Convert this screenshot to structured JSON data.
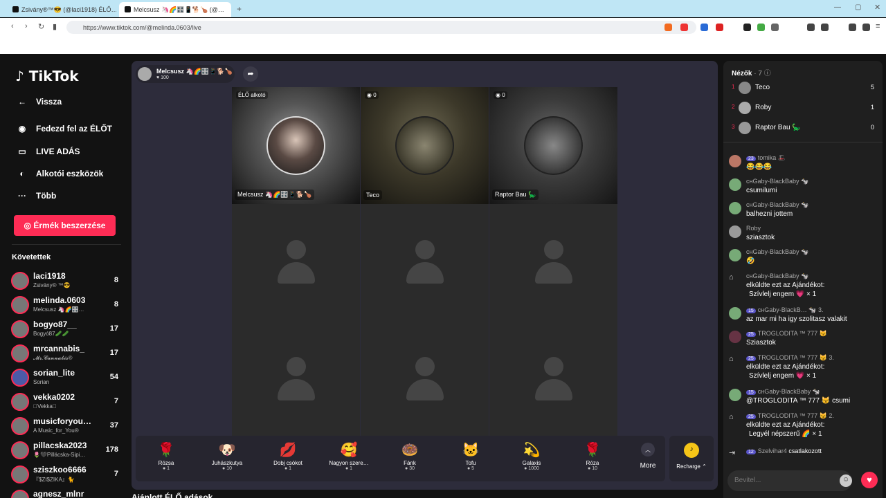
{
  "browser": {
    "tabs": [
      {
        "title": "Zsivány®™😎 (@laci1918) ÉLŐ…"
      },
      {
        "title": "Melcsusz 🦄🌈🎛️📱🐕🍗 (@…"
      }
    ],
    "url": "https://www.tiktok.com/@melinda.0603/live"
  },
  "sidebar": {
    "logo": "TikTok",
    "back": "Vissza",
    "items": [
      {
        "label": "Fedezd fel az ÉLŐT"
      },
      {
        "label": "LIVE ADÁS"
      },
      {
        "label": "Alkotói eszközök"
      },
      {
        "label": "Több"
      }
    ],
    "coins_button": "Érmék beszerzése",
    "following_title": "Követettek",
    "following": [
      {
        "name": "laci1918",
        "sub": "Zsivány® ™😎",
        "count": "8"
      },
      {
        "name": "melinda.0603",
        "sub": "Melcsusz 🦄🌈🎛️…",
        "count": "8"
      },
      {
        "name": "bogyo87__",
        "sub": "Bogyó87🥒🥒",
        "count": "17"
      },
      {
        "name": "mrcannabis_",
        "sub": "𝓜𝓻.𝓒𝓪𝓷𝓷𝓪𝓫𝓲𝓼®",
        "count": "17"
      },
      {
        "name": "sorian_lite",
        "sub": "Sorian",
        "count": "54"
      },
      {
        "name": "vekka0202",
        "sub": "⃟Vekka⃟",
        "count": "7"
      },
      {
        "name": "musicforyou…",
        "sub": "A Music_for_You®",
        "count": "37"
      },
      {
        "name": "pillacska2023",
        "sub": "🌷🖤Pillácska-Sipi…",
        "count": "178"
      },
      {
        "name": "sziszkoo6666",
        "sub": "『$ZI$ZIKA』🐈",
        "count": "7"
      },
      {
        "name": "agnesz_mlnr",
        "sub": "",
        "count": ""
      }
    ]
  },
  "stream": {
    "host_name": "Melcsusz 🦄🌈🎛️📱🐕🍗",
    "host_likes": "100",
    "host_badge": "ÉLŐ alkotó",
    "guests": [
      {
        "name": "Teco",
        "count": "0"
      },
      {
        "name": "Raptor Bau 🦕",
        "count": "0"
      }
    ],
    "host_caption": "Melcsusz 🦄🌈🎛️📱🐕🍗"
  },
  "gifts": [
    {
      "name": "Rózsa",
      "price": "1",
      "icon": "🌹"
    },
    {
      "name": "Juhászkutya",
      "price": "10",
      "icon": "🐶"
    },
    {
      "name": "Dobj csókot",
      "price": "1",
      "icon": "💋"
    },
    {
      "name": "Nagyon szere…",
      "price": "1",
      "icon": "🥰"
    },
    {
      "name": "Fánk",
      "price": "30",
      "icon": "🍩"
    },
    {
      "name": "Tofu",
      "price": "5",
      "icon": "🐱"
    },
    {
      "name": "Galaxis",
      "price": "1000",
      "icon": "💫"
    },
    {
      "name": "Róza",
      "price": "10",
      "icon": "🌹"
    }
  ],
  "more_label": "More",
  "recharge_label": "Recharge ⌃",
  "bottom_title": "Ajánlott ÉLŐ adások",
  "viewers": {
    "title": "Nézők",
    "count": "· 7",
    "list": [
      {
        "rank": "1",
        "name": "Teco",
        "score": "5"
      },
      {
        "rank": "2",
        "name": "Roby",
        "score": "1"
      },
      {
        "rank": "3",
        "name": "Raptor Bau 🦕",
        "score": "0"
      }
    ]
  },
  "chat": [
    {
      "user": "tomika 🎩",
      "level": "23",
      "text": "😂😂😂"
    },
    {
      "user": "cʜGaby-BlackBaby 🐄",
      "level": "",
      "text": "csumilumi"
    },
    {
      "user": "cʜGaby-BlackBaby 🐄",
      "level": "",
      "text": "balhezni jottem"
    },
    {
      "user": "Roby",
      "level": "",
      "text": "sziasztok"
    },
    {
      "user": "cʜGaby-BlackBaby 🐄",
      "level": "",
      "text": "🤣"
    },
    {
      "user": "cʜGaby-BlackBaby 🐄",
      "level": "",
      "text": "elküldte ezt az Ajándékot:",
      "text2": "Szívlelj engem 💗 × 1"
    },
    {
      "user": "cʜGaby-BlackB… 🐄 3.",
      "level": "15",
      "text": "az mar mi ha igy szolitasz valakit"
    },
    {
      "user": "TROGLODITA ™ 777 😼",
      "level": "25",
      "text": "Sziasztok"
    },
    {
      "user": "TROGLODITA ™ 777 😼 3.",
      "level": "25",
      "text": "elküldte ezt az Ajándékot:",
      "text2": "Szívlelj engem 💗 × 1"
    },
    {
      "user": "cʜGaby-BlackBaby 🐄",
      "level": "15",
      "text": "@TROGLODITA ™ 777 😼 csumi"
    },
    {
      "user": "TROGLODITA ™ 777 😼 2.",
      "level": "25",
      "text": "elküldte ezt az Ajándékot:",
      "text2": "Legyél népszerű 🌈 × 1"
    },
    {
      "user": "Szelvihar4",
      "level": "12",
      "text": "csatlakozott"
    }
  ],
  "chat_placeholder": "Bevitel..."
}
